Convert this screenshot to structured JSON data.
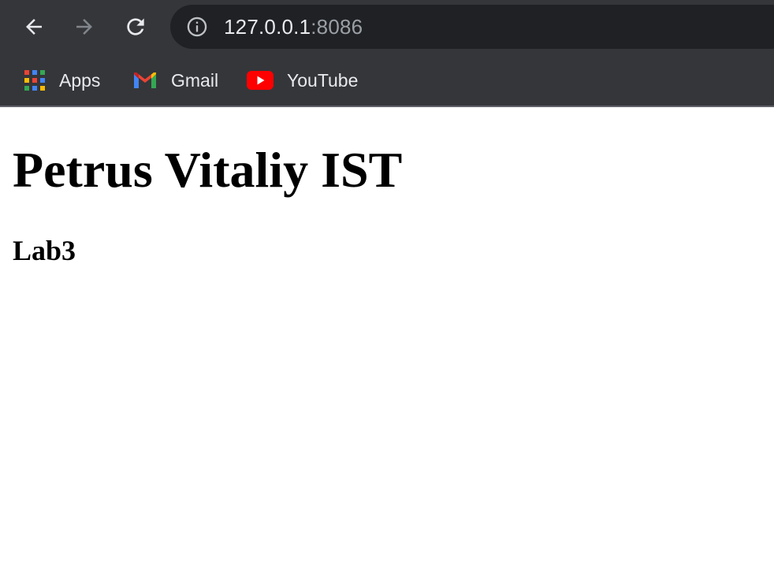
{
  "browser": {
    "url_host": "127.0.0.1",
    "url_port": ":8086",
    "icons": {
      "back": "back-arrow-icon",
      "forward": "forward-arrow-icon",
      "reload": "reload-icon",
      "site_info": "info-icon"
    },
    "bookmarks": [
      {
        "label": "Apps",
        "icon": "apps-grid-icon"
      },
      {
        "label": "Gmail",
        "icon": "gmail-icon"
      },
      {
        "label": "YouTube",
        "icon": "youtube-icon"
      }
    ],
    "colors": {
      "chrome_bg": "#35363a",
      "omnibox_bg": "#202124",
      "text": "#e8eaed",
      "muted_text": "#9aa0a6"
    }
  },
  "page": {
    "heading": "Petrus Vitaliy IST",
    "subheading": "Lab3"
  }
}
